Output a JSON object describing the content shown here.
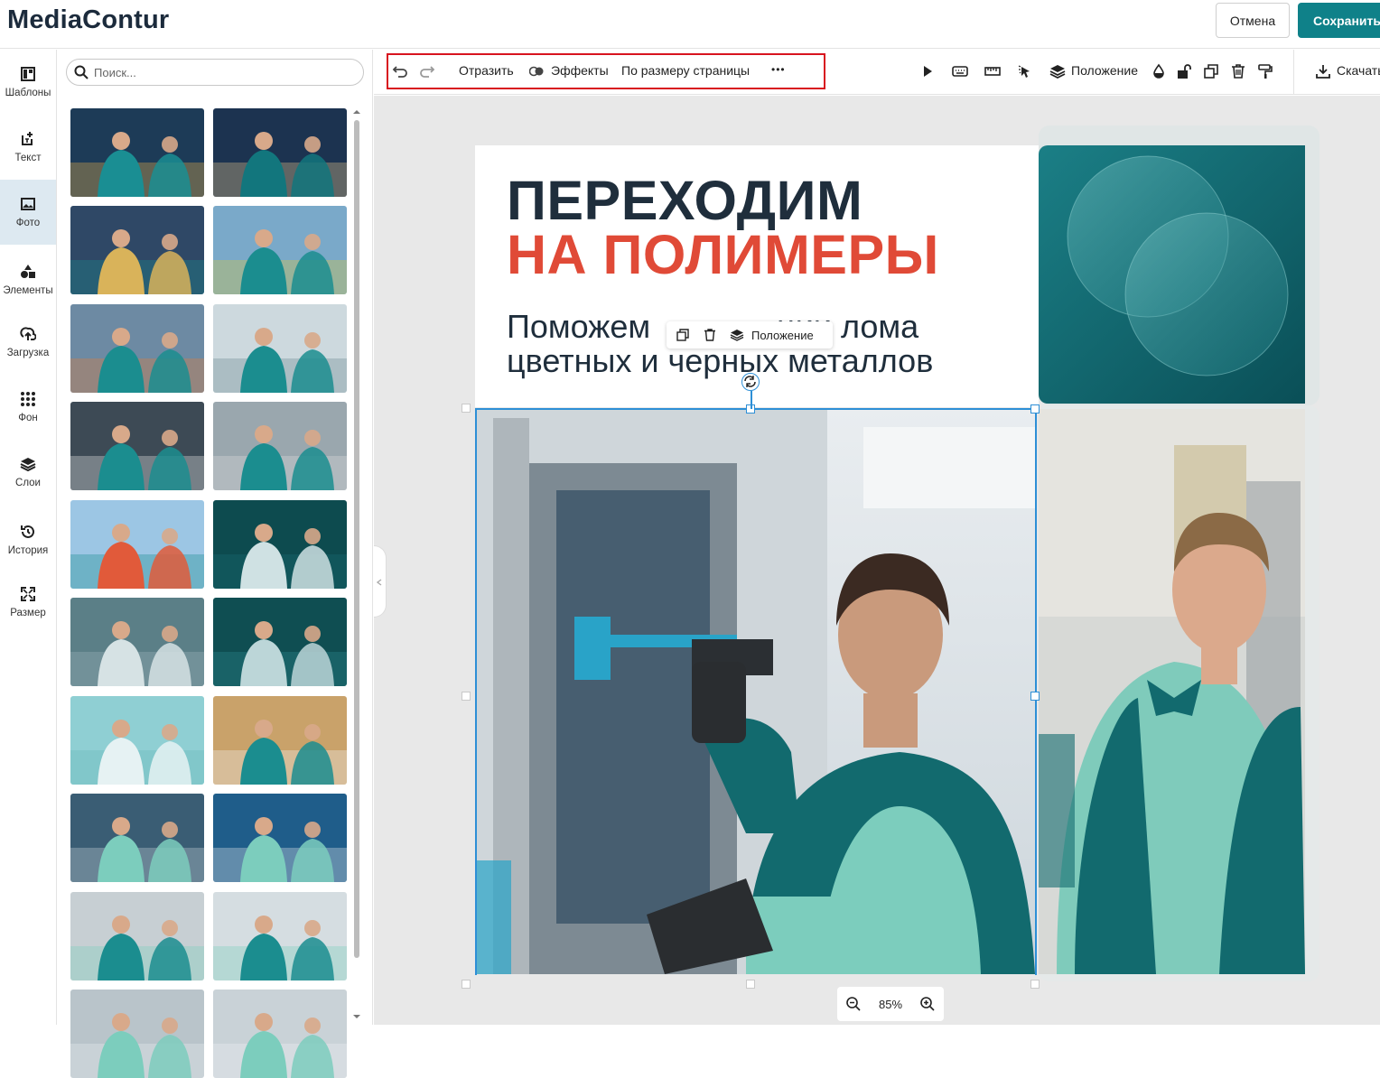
{
  "app": {
    "logo": "MediaContur",
    "cancel_label": "Отмена",
    "save_label": "Сохранить"
  },
  "colors": {
    "brand": "#0f8189",
    "accent_red": "#e04a37",
    "selection": "#2d8fd6",
    "highlight_box": "#d8141f"
  },
  "nav": {
    "items": [
      {
        "label": "Шаблоны",
        "icon": "templates-icon"
      },
      {
        "label": "Текст",
        "icon": "text-icon"
      },
      {
        "label": "Фото",
        "icon": "photo-icon",
        "active": true
      },
      {
        "label": "Элементы",
        "icon": "elements-icon"
      },
      {
        "label": "Загрузка",
        "icon": "upload-icon"
      },
      {
        "label": "Фон",
        "icon": "background-icon"
      },
      {
        "label": "Слои",
        "icon": "layers-icon"
      },
      {
        "label": "История",
        "icon": "history-icon"
      },
      {
        "label": "Размер",
        "icon": "resize-icon"
      }
    ]
  },
  "panel": {
    "search_placeholder": "Поиск..."
  },
  "toolbar": {
    "flip_label": "Отразить",
    "effects_label": "Эффекты",
    "fit_label": "По размеру страницы",
    "more_label": "•••",
    "position_label": "Положение",
    "download_label": "Скачать"
  },
  "design": {
    "title_line1": "ПЕРЕХОДИМ",
    "title_line2": "НА ПОЛИМЕРЫ",
    "subtitle": "Поможем с закупкой и реализации лома цветных и черных металлов",
    "subtitle_visible": "Поможем              ции лома цветных и черных металлов"
  },
  "context_menu": {
    "position_label": "Положение"
  },
  "zoom": {
    "value": "85%"
  }
}
